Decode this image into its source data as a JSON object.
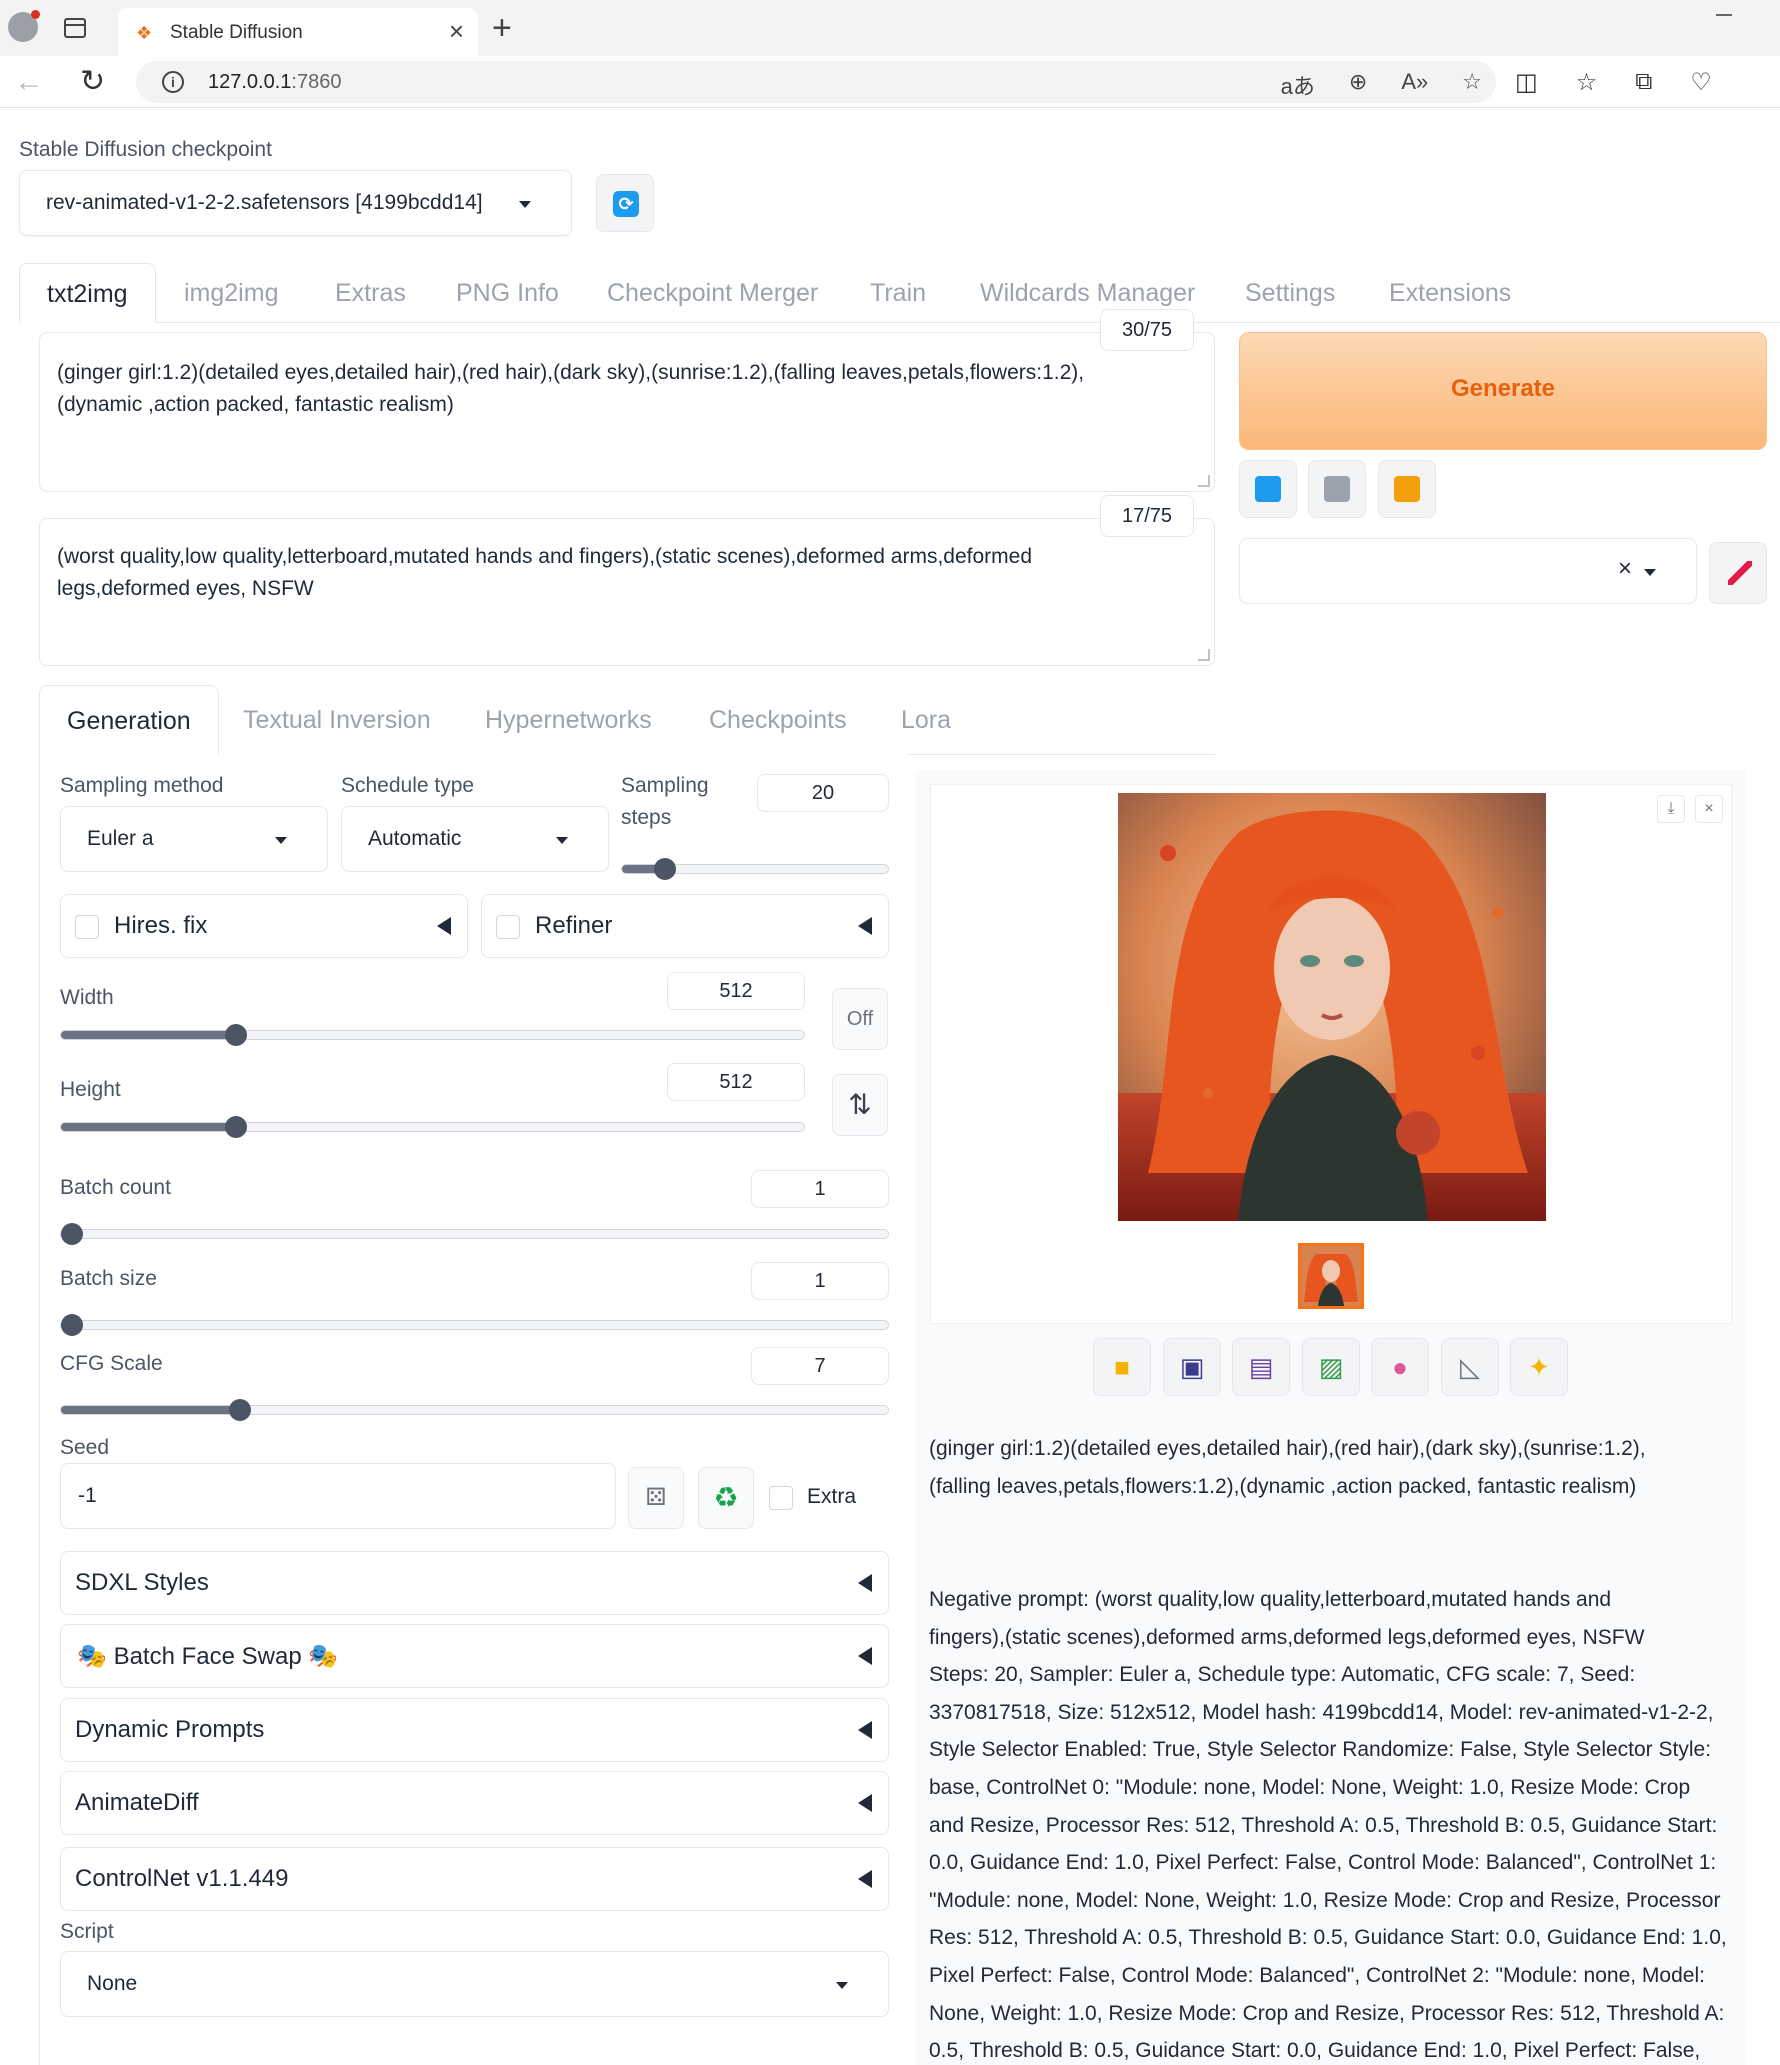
{
  "browser": {
    "tab_title": "Stable Diffusion",
    "url_host": "127.0.0.1",
    "url_port": ":7860"
  },
  "checkpoint": {
    "label": "Stable Diffusion checkpoint",
    "value": "rev-animated-v1-2-2.safetensors [4199bcdd14]"
  },
  "main_tabs": [
    "txt2img",
    "img2img",
    "Extras",
    "PNG Info",
    "Checkpoint Merger",
    "Train",
    "Wildcards Manager",
    "Settings",
    "Extensions"
  ],
  "prompt": {
    "counter": "30/75",
    "line1": "(ginger girl:1.2)(detailed eyes,detailed hair),(red hair),(dark sky),(sunrise:1.2),(falling leaves,petals,flowers:1.2),",
    "line2": "(dynamic ,action packed, fantastic realism)"
  },
  "negative_prompt": {
    "counter": "17/75",
    "line1": "(worst quality,low quality,letterboard,mutated hands and fingers),(static scenes),deformed arms,deformed",
    "line2": "legs,deformed eyes, NSFW"
  },
  "generate_label": "Generate",
  "sub_tabs": [
    "Generation",
    "Textual Inversion",
    "Hypernetworks",
    "Checkpoints",
    "Lora"
  ],
  "generation": {
    "sampling_method_label": "Sampling method",
    "sampling_method": "Euler a",
    "schedule_type_label": "Schedule type",
    "schedule_type": "Automatic",
    "sampling_steps_label_1": "Sampling",
    "sampling_steps_label_2": "steps",
    "sampling_steps": "20",
    "hires_fix": "Hires. fix",
    "refiner": "Refiner",
    "width_label": "Width",
    "width": "512",
    "height_label": "Height",
    "height": "512",
    "off_label": "Off",
    "swap_label": "⇅",
    "batch_count_label": "Batch count",
    "batch_count": "1",
    "batch_size_label": "Batch size",
    "batch_size": "1",
    "cfg_label": "CFG Scale",
    "cfg": "7",
    "seed_label": "Seed",
    "seed": "-1",
    "extra_label": "Extra",
    "script_label": "Script",
    "script": "None"
  },
  "slider_levels": {
    "sampling_steps": 0.16,
    "width": 0.236,
    "height": 0.236,
    "batch_count": 0.0,
    "batch_size": 0.0,
    "cfg": 0.216
  },
  "accordions": [
    "SDXL Styles",
    "Batch Face Swap",
    "Dynamic Prompts",
    "AnimateDiff",
    "ControlNet v1.1.449"
  ],
  "output": {
    "prompt_line1": "(ginger girl:1.2)(detailed eyes,detailed hair),(red hair),(dark sky),(sunrise:1.2),",
    "prompt_line2": "(falling leaves,petals,flowers:1.2),(dynamic ,action packed, fantastic realism)",
    "params": [
      "Negative prompt: (worst quality,low quality,letterboard,mutated hands and",
      "fingers),(static scenes),deformed arms,deformed legs,deformed eyes, NSFW",
      "Steps: 20, Sampler: Euler a, Schedule type: Automatic, CFG scale: 7, Seed:",
      "3370817518, Size: 512x512, Model hash: 4199bcdd14, Model: rev-animated-v1-2-2,",
      "Style Selector Enabled: True, Style Selector Randomize: False, Style Selector Style:",
      "base, ControlNet 0: \"Module: none, Model: None, Weight: 1.0, Resize Mode: Crop",
      "and Resize, Processor Res: 512, Threshold A: 0.5, Threshold B: 0.5, Guidance Start:",
      "0.0, Guidance End: 1.0, Pixel Perfect: False, Control Mode: Balanced\", ControlNet 1:",
      "\"Module: none, Model: None, Weight: 1.0, Resize Mode: Crop and Resize, Processor",
      "Res: 512, Threshold A: 0.5, Threshold B: 0.5, Guidance Start: 0.0, Guidance End: 1.0,",
      "Pixel Perfect: False, Control Mode: Balanced\", ControlNet 2: \"Module: none, Model:",
      "None, Weight: 1.0, Resize Mode: Crop and Resize, Processor Res: 512, Threshold A:",
      "0.5, Threshold B: 0.5, Guidance Start: 0.0, Guidance End: 1.0, Pixel Perfect: False,"
    ]
  },
  "colors": {
    "accent_orange": "#e8600d",
    "generate_bg": "#fbb777",
    "thumb_border": "#f97316"
  }
}
